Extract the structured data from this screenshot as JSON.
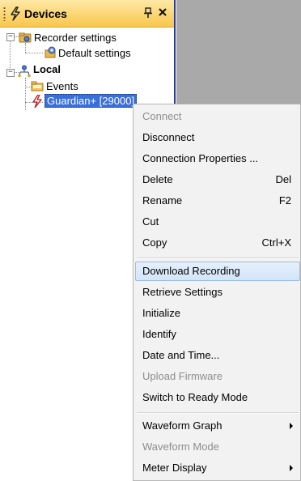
{
  "panel": {
    "title": "Devices",
    "pin_glyph": "⭿",
    "close_glyph": "✕"
  },
  "tree": {
    "recorder_settings": {
      "label": "Recorder settings",
      "icon": "recorder-settings-icon"
    },
    "default_settings": {
      "label": "Default settings",
      "icon": "settings-icon"
    },
    "local": {
      "label": "Local",
      "icon": "network-icon"
    },
    "events": {
      "label": "Events",
      "icon": "folder-icon"
    },
    "device": {
      "label": "Guardian+ [29000]",
      "icon": "lightning-icon"
    }
  },
  "context_menu": {
    "items": [
      {
        "label": "Connect",
        "shortcut": "",
        "disabled": true
      },
      {
        "label": "Disconnect",
        "shortcut": "",
        "disabled": false
      },
      {
        "label": "Connection Properties ...",
        "shortcut": "",
        "disabled": false
      },
      {
        "label": "Delete",
        "shortcut": "Del",
        "disabled": false
      },
      {
        "label": "Rename",
        "shortcut": "F2",
        "disabled": false
      },
      {
        "label": "Cut",
        "shortcut": "",
        "disabled": false
      },
      {
        "label": "Copy",
        "shortcut": "Ctrl+X",
        "disabled": false
      },
      {
        "label": "Download Recording",
        "shortcut": "",
        "disabled": false,
        "highlighted": true
      },
      {
        "label": "Retrieve Settings",
        "shortcut": "",
        "disabled": false
      },
      {
        "label": "Initialize",
        "shortcut": "",
        "disabled": false
      },
      {
        "label": "Identify",
        "shortcut": "",
        "disabled": false
      },
      {
        "label": "Date and Time...",
        "shortcut": "",
        "disabled": false
      },
      {
        "label": "Upload Firmware",
        "shortcut": "",
        "disabled": true
      },
      {
        "label": "Switch to Ready Mode",
        "shortcut": "",
        "disabled": false
      },
      {
        "label": "Waveform Graph",
        "shortcut": "",
        "disabled": false,
        "submenu": true
      },
      {
        "label": "Waveform Mode",
        "shortcut": "",
        "disabled": true
      },
      {
        "label": "Meter Display",
        "shortcut": "",
        "disabled": false,
        "submenu": true
      }
    ]
  },
  "colors": {
    "panel_header": "#f8c64c",
    "selection": "#3a6fd9",
    "menu_highlight": "#d3e5f8",
    "workspace": "#a9a9a9"
  }
}
